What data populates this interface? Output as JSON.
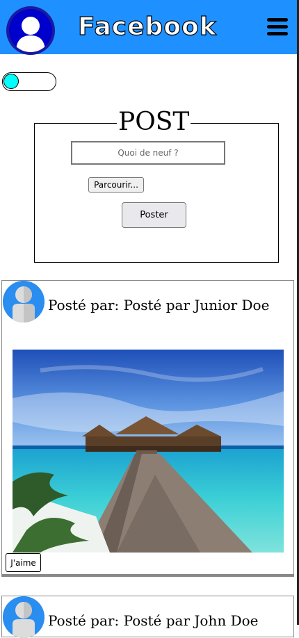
{
  "header": {
    "app_name": "Facebook",
    "brand_color": "#1e90ff"
  },
  "theme_toggle": {
    "state": "off"
  },
  "post_form": {
    "title": "POST",
    "input_placeholder": "Quoi de neuf ?",
    "browse_label": "Parcourir...",
    "submit_label": "Poster"
  },
  "feed": [
    {
      "author": "Posté par: Posté par Junior Doe",
      "image": "tropical-pier-photo",
      "like_label": "J'aime"
    },
    {
      "author": "Posté par: Posté par John Doe"
    }
  ]
}
